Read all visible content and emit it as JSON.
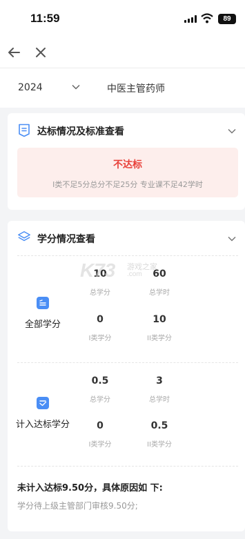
{
  "status_bar": {
    "time": "11:59",
    "battery": "89"
  },
  "nav": {
    "back_icon": "arrow-left-icon",
    "close_icon": "close-icon"
  },
  "filter": {
    "year": "2024",
    "profession": "中医主管药师"
  },
  "standard_card": {
    "title": "达标情况及标准查看",
    "result": "不达标",
    "detail": "I类不足5分总分不足25分 专业课不足42学时"
  },
  "credit_card": {
    "title": "学分情况查看",
    "groups": [
      {
        "label": "全部学分",
        "stats": [
          {
            "value": "10",
            "label": "总学分"
          },
          {
            "value": "60",
            "label": "总学时"
          },
          {
            "value": "0",
            "label": "I类学分"
          },
          {
            "value": "10",
            "label": "II类学分"
          }
        ]
      },
      {
        "label": "计入达标学分",
        "stats": [
          {
            "value": "0.5",
            "label": "总学分"
          },
          {
            "value": "3",
            "label": "总学时"
          },
          {
            "value": "0",
            "label": "I类学分"
          },
          {
            "value": "0.5",
            "label": "II类学分"
          }
        ]
      }
    ],
    "footer_title": "未计入达标9.50分，具体原因如 下:",
    "footer_reason": "学分待上级主管部门审核9.50分;"
  },
  "watermark": {
    "logo": "K73",
    "name": "游戏之家",
    "url": ".com"
  },
  "colors": {
    "accent": "#4a8ef5",
    "error": "#e8413a",
    "error_bg": "#fdeeec"
  }
}
